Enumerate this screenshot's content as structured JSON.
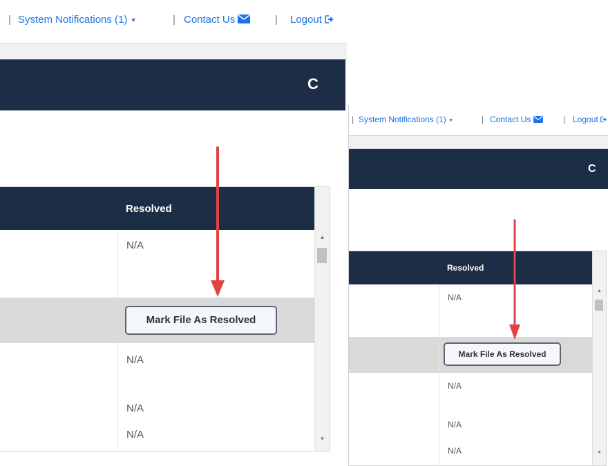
{
  "nav": {
    "separator": "|",
    "notifications_label": "System Notifications (1)",
    "notifications_caret": "▼",
    "contact_label": "Contact Us",
    "logout_label": "Logout"
  },
  "toolbar": {
    "refresh_icon_glyph": "C"
  },
  "table": {
    "header_resolved": "Resolved",
    "rows": [
      {
        "resolved": "N/A",
        "highlighted": false
      },
      {
        "resolved": "Mark File As Resolved",
        "highlighted": true,
        "is_button": true
      },
      {
        "resolved": "N/A",
        "highlighted": false
      },
      {
        "resolved": "N/A",
        "highlighted": false
      },
      {
        "resolved": "N/A",
        "highlighted": false
      }
    ],
    "scroll_up": "▲",
    "scroll_down": "▼"
  },
  "colors": {
    "header_bg": "#1c2d45",
    "link": "#1a73e8",
    "annotation_arrow": "#e04444",
    "highlight_row": "#d9d9d9"
  }
}
